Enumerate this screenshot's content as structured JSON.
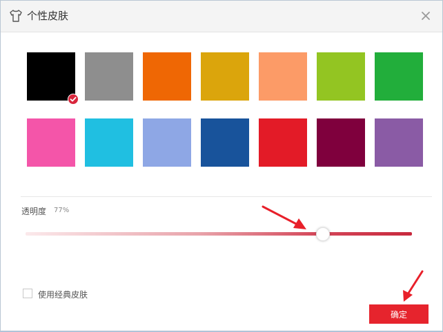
{
  "dialog": {
    "title": "个性皮肤",
    "icons": {
      "title": "tshirt-icon",
      "close": "close-icon",
      "selected": "check-icon"
    },
    "swatches": [
      [
        "#000000",
        "#8e8e8e",
        "#ef6704",
        "#dba50c",
        "#fc9b67",
        "#93c522",
        "#22ae3b"
      ],
      [
        "#f455a9",
        "#20bfe1",
        "#8ea7e5",
        "#18539b",
        "#e31b27",
        "#7f003d",
        "#8a5ba5"
      ]
    ],
    "selected_swatch": 0,
    "opacity": {
      "label": "透明度",
      "value_text": "77%",
      "value": 0.77
    },
    "classic_skin": {
      "label": "使用经典皮肤",
      "checked": false
    },
    "ok_label": "确定",
    "accent": "#e6242d"
  }
}
